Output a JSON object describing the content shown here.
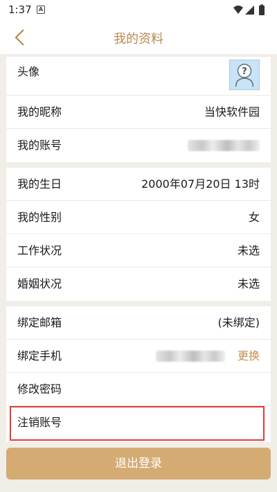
{
  "status_bar": {
    "time": "1:37",
    "notif_letter": "A"
  },
  "header": {
    "title": "我的资料"
  },
  "profile": {
    "avatar_label": "头像",
    "nickname_label": "我的昵称",
    "nickname_value": "当快软件园",
    "account_label": "我的账号"
  },
  "personal": {
    "birthday_label": "我的生日",
    "birthday_value": "2000年07月20日 13时",
    "gender_label": "我的性别",
    "gender_value": "女",
    "work_label": "工作状况",
    "work_value": "未选",
    "marriage_label": "婚姻状况",
    "marriage_value": "未选"
  },
  "security": {
    "email_label": "绑定邮箱",
    "email_value": "(未绑定)",
    "phone_label": "绑定手机",
    "phone_action": "更换",
    "password_label": "修改密码",
    "cancel_account_label": "注销账号"
  },
  "logout_label": "退出登录",
  "colors": {
    "accent": "#b98a4f",
    "button": "#d5ab74",
    "highlight": "#e23a3a",
    "background": "#f1eee8"
  },
  "icons": [
    "back-icon",
    "wifi-icon",
    "signal-icon",
    "battery-icon",
    "avatar-placeholder-icon"
  ]
}
